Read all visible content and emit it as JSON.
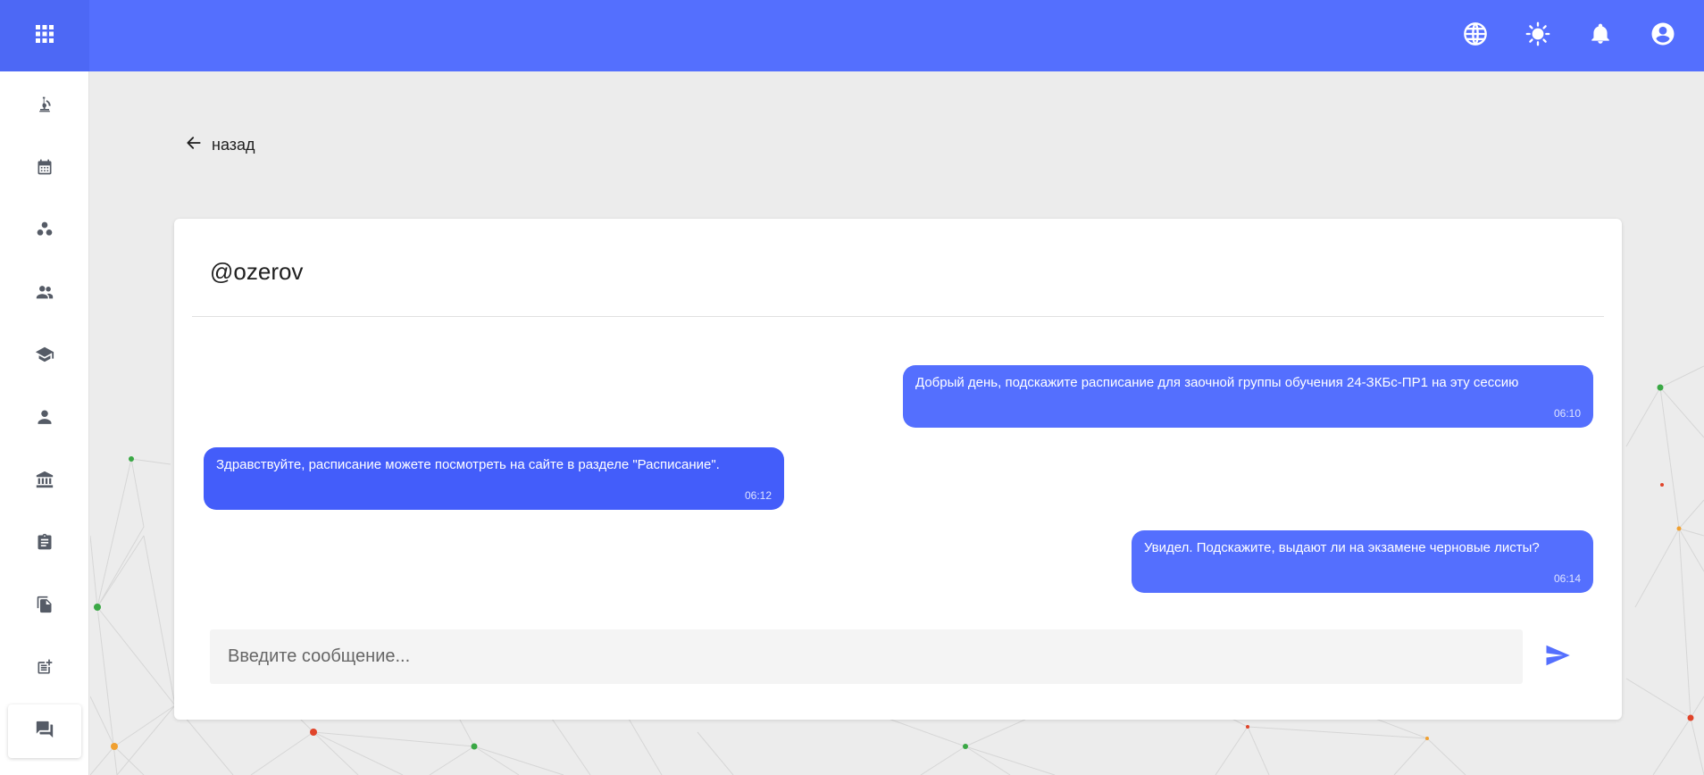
{
  "topbar": {
    "apps_icon": "grid-icon",
    "icons": [
      "globe-icon",
      "sun-icon",
      "bell-icon",
      "account-circle-icon"
    ]
  },
  "sidebar": {
    "items": [
      {
        "icon": "microscope-icon",
        "active": false
      },
      {
        "icon": "calendar-icon",
        "active": false
      },
      {
        "icon": "groups-icon",
        "active": false
      },
      {
        "icon": "people-icon",
        "active": false
      },
      {
        "icon": "graduation-cap-icon",
        "active": false
      },
      {
        "icon": "person-icon",
        "active": false
      },
      {
        "icon": "institution-icon",
        "active": false
      },
      {
        "icon": "clipboard-icon",
        "active": false
      },
      {
        "icon": "documents-icon",
        "active": false
      },
      {
        "icon": "post-add-icon",
        "active": false
      },
      {
        "icon": "forum-icon",
        "active": true
      }
    ]
  },
  "back_label": "назад",
  "chat": {
    "title": "@ozerov",
    "messages": [
      {
        "direction": "outgoing",
        "text": "Добрый день, подскажите расписание для заочной группы обучения 24-ЗКБс-ПР1 на эту сессию",
        "time": "06:10"
      },
      {
        "direction": "incoming",
        "text": "Здравствуйте, расписание можете посмотреть на сайте в разделе \"Расписание\".",
        "time": "06:12"
      },
      {
        "direction": "outgoing",
        "text": "Увидел. Подскажите, выдают ли на экзамене черновые листы?",
        "time": "06:14"
      }
    ],
    "input_placeholder": "Введите сообщение...",
    "input_value": "",
    "send_icon": "send-icon"
  },
  "colors": {
    "accent": "#546ffe",
    "incoming_bubble": "#435dfa",
    "background": "#ececec"
  }
}
